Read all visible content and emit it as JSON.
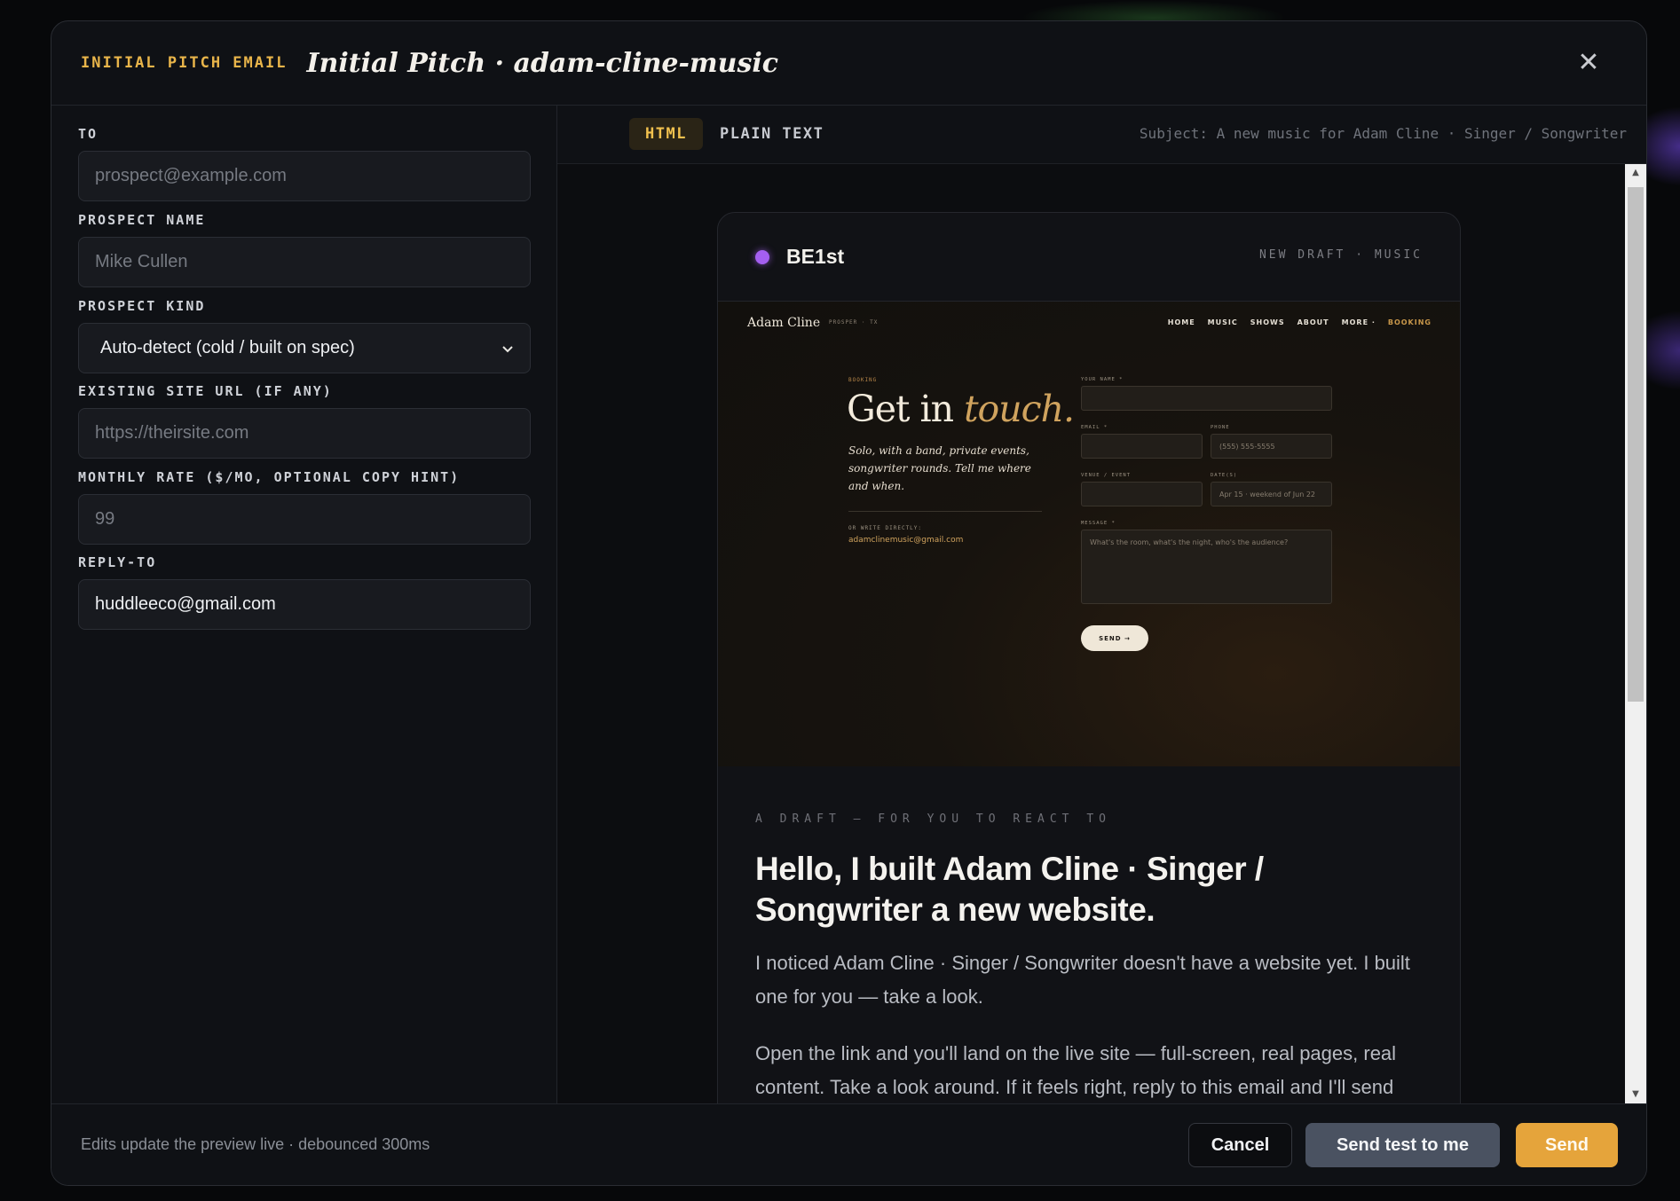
{
  "header": {
    "kicker": "INITIAL PITCH EMAIL",
    "title": "Initial Pitch · adam-cline-music",
    "close_glyph": "✕"
  },
  "form": {
    "to": {
      "label": "TO",
      "placeholder": "prospect@example.com",
      "value": ""
    },
    "prospect_name": {
      "label": "PROSPECT NAME",
      "placeholder": "Mike Cullen",
      "value": ""
    },
    "prospect_kind": {
      "label": "PROSPECT KIND",
      "selected": "Auto-detect (cold / built on spec)"
    },
    "existing_site": {
      "label": "EXISTING SITE URL (IF ANY)",
      "placeholder": "https://theirsite.com",
      "value": ""
    },
    "monthly_rate": {
      "label": "MONTHLY RATE ($/MO, OPTIONAL COPY HINT)",
      "placeholder": "99",
      "value": ""
    },
    "reply_to": {
      "label": "REPLY-TO",
      "value": "huddleeco@gmail.com"
    }
  },
  "preview": {
    "tabs": [
      {
        "label": "HTML",
        "active": true
      },
      {
        "label": "PLAIN TEXT",
        "active": false
      }
    ],
    "subject": "Subject: A new music for Adam Cline · Singer / Songwriter",
    "card": {
      "brand": "BE1st",
      "brand_dot_color": "#a45ff0",
      "draft_tag": "NEW DRAFT · MUSIC"
    },
    "site_shot": {
      "logo": "Adam Cline",
      "location": "PROSPER · TX",
      "nav": [
        "HOME",
        "MUSIC",
        "SHOWS",
        "ABOUT",
        "MORE ·"
      ],
      "nav_highlight": "BOOKING",
      "kicker": "BOOKING",
      "heading_plain": "Get in ",
      "heading_accent": "touch.",
      "subtext": "Solo, with a band, private events, songwriter rounds. Tell me where and when.",
      "write_label": "OR WRITE DIRECTLY:",
      "write_email": "adamclinemusic@gmail.com",
      "labels": {
        "name": "YOUR NAME *",
        "email": "EMAIL *",
        "phone": "PHONE",
        "venue": "VENUE / EVENT",
        "dates": "DATE(S)",
        "message": "MESSAGE *"
      },
      "placeholders": {
        "phone": "(555) 555-5555",
        "dates": "Apr 15 · weekend of Jun 22",
        "message": "What's the room, what's the night, who's the audience?"
      },
      "send": "SEND →"
    },
    "body": {
      "eyebrow": "A DRAFT — FOR YOU TO REACT TO",
      "headline": "Hello, I built Adam Cline · Singer / Songwriter a new website.",
      "para1": "I noticed Adam Cline · Singer / Songwriter doesn't have a website yet. I built one for you — take a look.",
      "para2": "Open the link and you'll land on the live site — full-screen, real pages, real content. Take a look around. If it feels right, reply to this email and I'll send"
    }
  },
  "footer": {
    "note": "Edits update the preview live · debounced 300ms",
    "cancel": "Cancel",
    "send_test": "Send test to me",
    "send": "Send"
  },
  "colors": {
    "accent_gold": "#e9b54a",
    "send_button": "#e5a43b",
    "test_button": "#4a5261"
  }
}
